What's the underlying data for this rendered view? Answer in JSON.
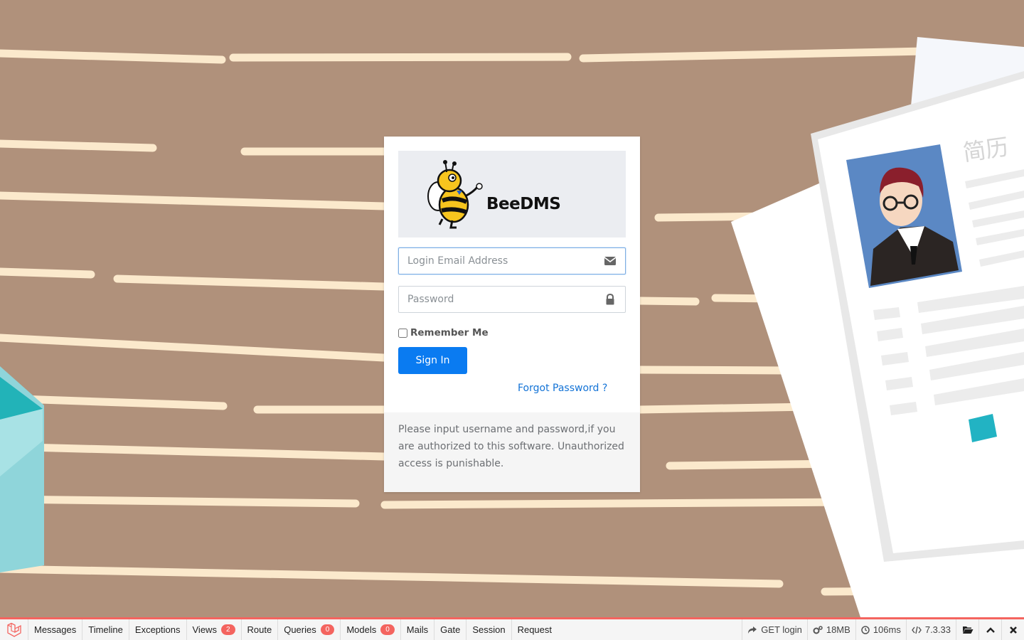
{
  "login": {
    "brand": "BeeDMS",
    "email_placeholder": "Login Email Address",
    "password_placeholder": "Password",
    "remember_label": "Remember Me",
    "signin_label": "Sign In",
    "forgot_label": "Forgot Password ?",
    "notice": "Please input username and password,if you are authorized to this software. Unauthorized access is punishable."
  },
  "background": {
    "resume_title": "简历"
  },
  "debugbar": {
    "tabs": [
      {
        "label": "Messages"
      },
      {
        "label": "Timeline"
      },
      {
        "label": "Exceptions"
      },
      {
        "label": "Views",
        "badge": "2"
      },
      {
        "label": "Route"
      },
      {
        "label": "Queries",
        "badge": "0"
      },
      {
        "label": "Models",
        "badge": "0"
      },
      {
        "label": "Mails"
      },
      {
        "label": "Gate"
      },
      {
        "label": "Session"
      },
      {
        "label": "Request"
      }
    ],
    "route": "GET login",
    "memory": "18MB",
    "time": "106ms",
    "php_version": "7.3.33",
    "accent_color": "#f4645f"
  },
  "colors": {
    "background": "#b0917b",
    "primary_button": "#0a7bf1",
    "link": "#1373d6"
  }
}
